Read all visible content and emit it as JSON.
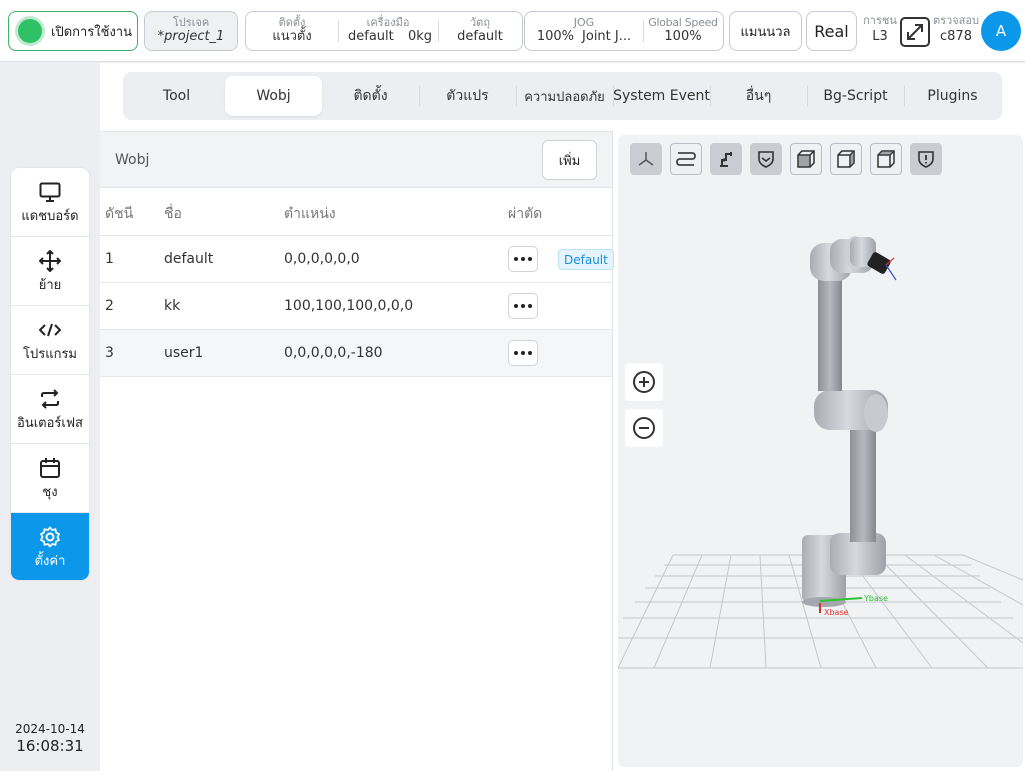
{
  "topbar": {
    "power_label": "เปิดการใช้งาน",
    "project": {
      "caption": "โปรเจค",
      "value": "*project_1"
    },
    "install": {
      "caption": "ติดตั้ง",
      "value": "แนวตั้ง"
    },
    "tool": {
      "caption": "เครื่องมือ",
      "name": "default",
      "load": "0kg"
    },
    "workpiece": {
      "caption": "วัตถุ",
      "value": "default"
    },
    "jog": {
      "caption": "JOG",
      "percent": "100%",
      "mode": "Joint J..."
    },
    "global_speed": {
      "caption": "Global Speed",
      "value": "100%"
    },
    "manual_label": "แมนนวล",
    "real_label": "Real",
    "collision": {
      "caption": "การชน",
      "value": "L3"
    },
    "check": {
      "caption": "ตรวจสอบ",
      "value": "c878"
    },
    "avatar_letter": "A"
  },
  "nav": [
    {
      "label": "แดชบอร์ด",
      "icon": "monitor-icon"
    },
    {
      "label": "ย้าย",
      "icon": "move-icon"
    },
    {
      "label": "โปรแกรม",
      "icon": "code-icon"
    },
    {
      "label": "อินเตอร์เฟส",
      "icon": "interface-icon"
    },
    {
      "label": "ชุง",
      "icon": "calendar-icon"
    },
    {
      "label": "ตั้งค่า",
      "icon": "settings-icon"
    }
  ],
  "datetime": {
    "date": "2024-10-14",
    "time": "16:08:31"
  },
  "tabs": [
    "Tool",
    "Wobj",
    "ติดตั้ง",
    "ตัวแปร",
    "ความปลอดภัย",
    "System Event",
    "อื่นๆ",
    "Bg-Script",
    "Plugins"
  ],
  "active_tab": "Wobj",
  "panel": {
    "title": "Wobj",
    "add_label": "เพิ่ม",
    "columns": [
      "ดัชนี",
      "ชื่อ",
      "ตำแหน่ง",
      "ผ่าตัด"
    ],
    "rows": [
      {
        "index": "1",
        "name": "default",
        "position": "0,0,0,0,0,0",
        "badge": "Default"
      },
      {
        "index": "2",
        "name": "kk",
        "position": "100,100,100,0,0,0",
        "badge": ""
      },
      {
        "index": "3",
        "name": "user1",
        "position": "0,0,0,0,0,-180",
        "badge": ""
      }
    ]
  },
  "view3d": {
    "toolbar": [
      "axes-icon",
      "path-icon",
      "robot-icon",
      "shield-icon",
      "cube-front-icon",
      "cube-side-icon",
      "cube-top-icon",
      "alert-shield-icon"
    ],
    "axis_labels": {
      "x": "Xbase",
      "y": "Ybase"
    },
    "colors": {
      "active_blue": "#0b98ea",
      "robot_grey": "#b8bcc2"
    }
  }
}
